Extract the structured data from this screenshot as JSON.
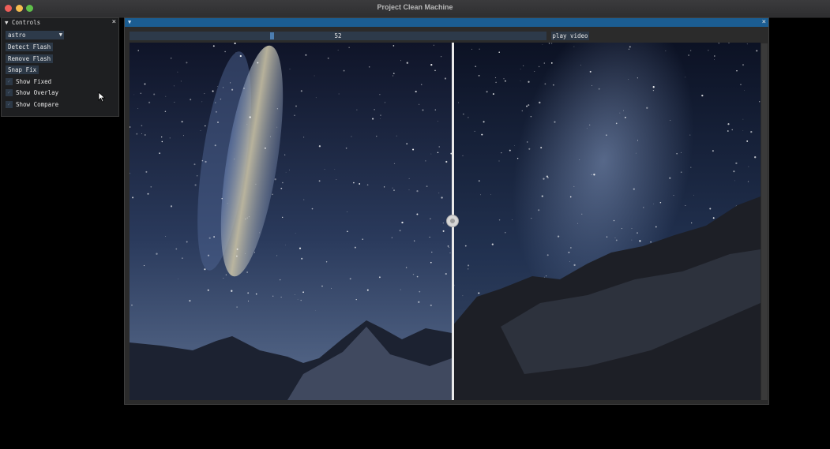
{
  "window": {
    "title": "Project Clean Machine"
  },
  "controls": {
    "title": "Controls",
    "preset": "astro",
    "buttons": {
      "detect": "Detect Flash",
      "remove": "Remove Flash",
      "snap": "Snap Fix"
    },
    "checkboxes": {
      "fixed": "Show Fixed",
      "overlay": "Show Overlay",
      "compare": "Show Compare"
    }
  },
  "viewer": {
    "frame_value": "52",
    "frame_fraction": 0.34,
    "play_label": "play video",
    "compare_split": 0.51
  },
  "colors": {
    "accent": "#1b5d92",
    "button": "#2c3846"
  },
  "icons": {
    "close": "close-icon",
    "collapse": "collapse-triangle-icon",
    "dropdown": "dropdown-arrow-icon"
  }
}
